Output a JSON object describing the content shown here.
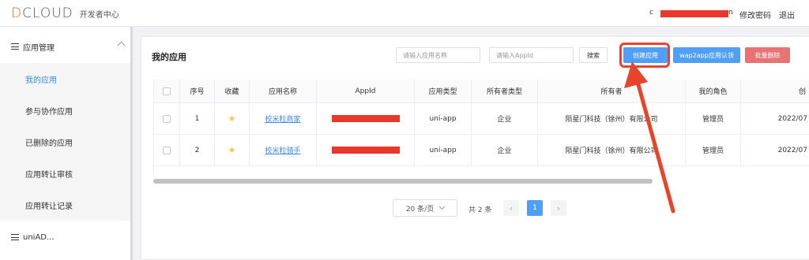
{
  "header": {
    "logo_text": "DCLOUD",
    "logo_first": "D",
    "logo_rest": "CLOUD",
    "subtitle": "开发者中心",
    "user_prefix": "c",
    "user_suffix": "n",
    "link_change_password": "修改密码",
    "link_logout": "退出"
  },
  "sidebar": {
    "group_app": "应用管理",
    "items": [
      {
        "label": "我的应用",
        "active": true
      },
      {
        "label": "参与协作应用",
        "active": false
      },
      {
        "label": "已删除的应用",
        "active": false
      },
      {
        "label": "应用转让审核",
        "active": false
      },
      {
        "label": "应用转让记录",
        "active": false
      }
    ],
    "group_uniad": "uniAD..."
  },
  "main": {
    "title": "我的应用",
    "search_name_placeholder": "请输入应用名称",
    "search_appid_placeholder": "请输入AppId",
    "btn_search": "搜索",
    "btn_create": "创建应用",
    "btn_wap2app": "wap2app应用认领",
    "btn_batch_delete": "批量删除"
  },
  "table": {
    "columns": [
      "序号",
      "收藏",
      "应用名称",
      "AppId",
      "应用类型",
      "所有者类型",
      "所有者",
      "我的角色",
      "创"
    ],
    "rows": [
      {
        "index": "1",
        "name": "校米粒商家",
        "type": "uni-app",
        "owner_type": "企业",
        "owner": "陨星门科技（徐州）有限公司",
        "role": "管理员",
        "created": "2022/07"
      },
      {
        "index": "2",
        "name": "校米粒骑手",
        "type": "uni-app",
        "owner_type": "企业",
        "owner": "陨星门科技（徐州）有限公司",
        "role": "管理员",
        "created": "2022/07"
      }
    ]
  },
  "pagination": {
    "page_size": "20 条/页",
    "total": "共 2 条",
    "current_page": "1",
    "prev_icon": "chevron-left-icon",
    "next_icon": "chevron-right-icon"
  },
  "colors": {
    "primary": "#4e9ff5",
    "danger": "#e87375",
    "link": "#3b8ae8",
    "annotation": "#e8442b",
    "redaction": "#e8372b"
  }
}
